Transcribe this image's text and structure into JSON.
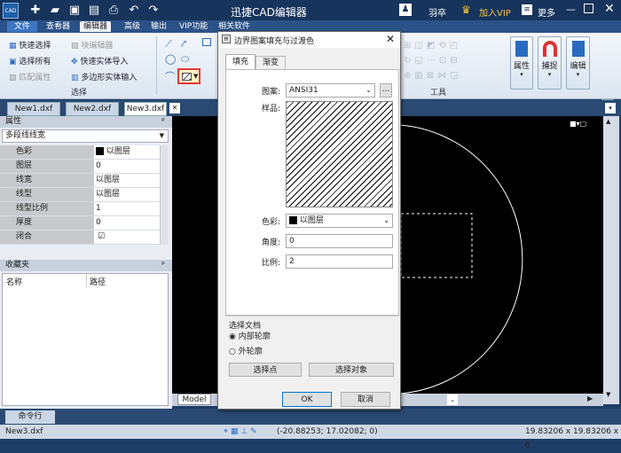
{
  "app": {
    "title": "迅捷CAD编辑器",
    "user": "羽卒",
    "vip": "加入VIP",
    "more": "更多",
    "logo": "CAD"
  },
  "menu": [
    "文件",
    "查看器",
    "编辑器",
    "高级",
    "输出",
    "VIP功能",
    "相关软件"
  ],
  "ribbon": {
    "select": {
      "quick_select": "快速选择",
      "block_editor": "块编辑器",
      "select_all": "选择所有",
      "quick_import": "快速实体导入",
      "match_props": "匹配属性",
      "poly_import": "多边形实体输入",
      "group_label": "选择"
    },
    "draw_group_label": "绘",
    "tools_label": "工具",
    "props_btn": "属性",
    "snap_btn": "捕捉",
    "edit_btn": "编辑"
  },
  "doc_tabs": [
    "New1.dxf",
    "New2.dxf",
    "New3.dxf"
  ],
  "props": {
    "header": "属性",
    "type": "多段线线宽",
    "rows": [
      {
        "k": "色彩",
        "v": "以图层"
      },
      {
        "k": "图层",
        "v": "0"
      },
      {
        "k": "线宽",
        "v": "以图层"
      },
      {
        "k": "线型",
        "v": "以图层"
      },
      {
        "k": "线型比例",
        "v": "1"
      },
      {
        "k": "厚度",
        "v": "0"
      },
      {
        "k": "闭合",
        "v": "☑"
      }
    ]
  },
  "favorites": {
    "header": "收藏夹",
    "col_name": "名称",
    "col_path": "路径"
  },
  "dialog": {
    "title": "边界图案填充与过渡色",
    "tabs": [
      "填充",
      "渐变"
    ],
    "pattern_label": "图案:",
    "pattern_value": "ANSI31",
    "browse": "...",
    "sample_label": "样品:",
    "color_label": "色彩:",
    "color_value": "以图层",
    "angle_label": "角度:",
    "angle_value": "0",
    "scale_label": "比例:",
    "scale_value": "2",
    "select_doc": "选择文档",
    "inner": "内部轮廓",
    "outer": "外轮廓",
    "pick_points": "选择点",
    "pick_objects": "选择对象",
    "ok": "OK",
    "cancel": "取消"
  },
  "model_tab": "Model",
  "cmd_tab": "命令行",
  "status": {
    "file": "New3.dxf",
    "coords": "(-20.88253; 17.02082; 0)",
    "size": "19.83206 x 19.83206 x 0"
  }
}
